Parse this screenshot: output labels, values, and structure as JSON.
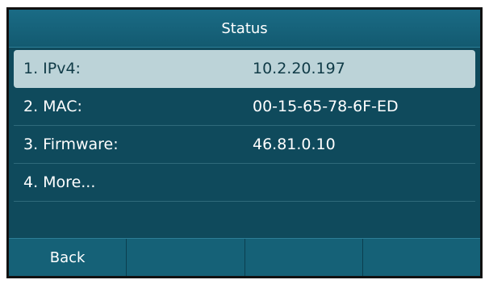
{
  "title": "Status",
  "items": [
    {
      "label": "1. IPv4:",
      "value": "10.2.20.197",
      "selected": true
    },
    {
      "label": "2. MAC:",
      "value": "00-15-65-78-6F-ED",
      "selected": false
    },
    {
      "label": "3. Firmware:",
      "value": "46.81.0.10",
      "selected": false
    },
    {
      "label": "4. More...",
      "value": "",
      "selected": false
    }
  ],
  "softkeys": [
    "Back",
    "",
    "",
    ""
  ],
  "colors": {
    "background": "#0f4a5c",
    "title_bar": "#1a6b85",
    "selected_row": "#bcd3d8",
    "softkey_bar": "#156177"
  }
}
